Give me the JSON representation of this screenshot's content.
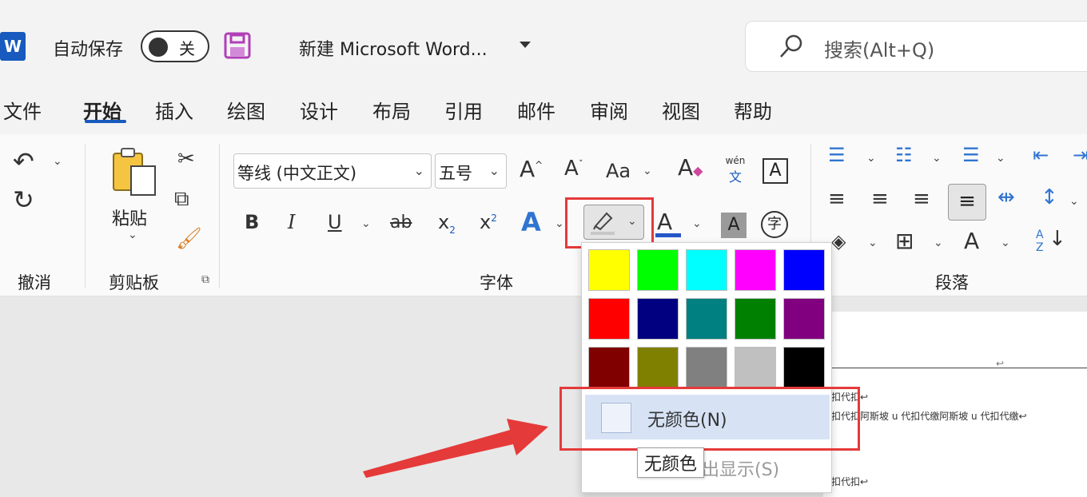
{
  "titlebar": {
    "logo_letter": "W",
    "autosave_label": "自动保存",
    "autosave_state": "关",
    "document_title": "新建 Microsoft Word...",
    "search_placeholder": "搜索(Alt+Q)"
  },
  "tabs": [
    "文件",
    "开始",
    "插入",
    "绘图",
    "设计",
    "布局",
    "引用",
    "邮件",
    "审阅",
    "视图",
    "帮助"
  ],
  "active_tab": "开始",
  "ribbon": {
    "undo_group_label": "撤消",
    "clipboard_group_label": "剪贴板",
    "paste_label": "粘贴",
    "font_group_label": "字体",
    "paragraph_group_label": "段落",
    "font_name": "等线 (中文正文)",
    "font_size": "五号",
    "grow_font": "A",
    "shrink_font": "A",
    "change_case": "Aa",
    "phonetic_top": "wén",
    "phonetic_bottom": "文",
    "bold": "B",
    "italic": "I",
    "underline": "U",
    "strikethrough": "ab",
    "subscript": "x",
    "subscript_mark": "2",
    "superscript": "x",
    "superscript_mark": "2",
    "text_effects": "A",
    "font_color": "A",
    "char_shading": "A",
    "enclosed_char": "字",
    "char_border": "A",
    "sort_icon_top": "A",
    "sort_icon_bottom": "Z"
  },
  "highlight_menu": {
    "colors": [
      "#ffff00",
      "#00ff00",
      "#00ffff",
      "#ff00ff",
      "#0000ff",
      "#ff0000",
      "#000080",
      "#008080",
      "#008000",
      "#800080",
      "#800000",
      "#808000",
      "#808080",
      "#c0c0c0",
      "#000000"
    ],
    "no_color_label": "无颜色(N)",
    "partial_item_label": "出显示(S)",
    "tooltip": "无颜色"
  },
  "document": {
    "lines": [
      "扣代扣↩",
      "扣代扣阿斯坡 u 代扣代缴阿斯坡 u 代扣代缴↩",
      "扣代扣↩"
    ]
  },
  "colors": {
    "accent": "#185abd",
    "highlight_border": "#e53a3a"
  }
}
